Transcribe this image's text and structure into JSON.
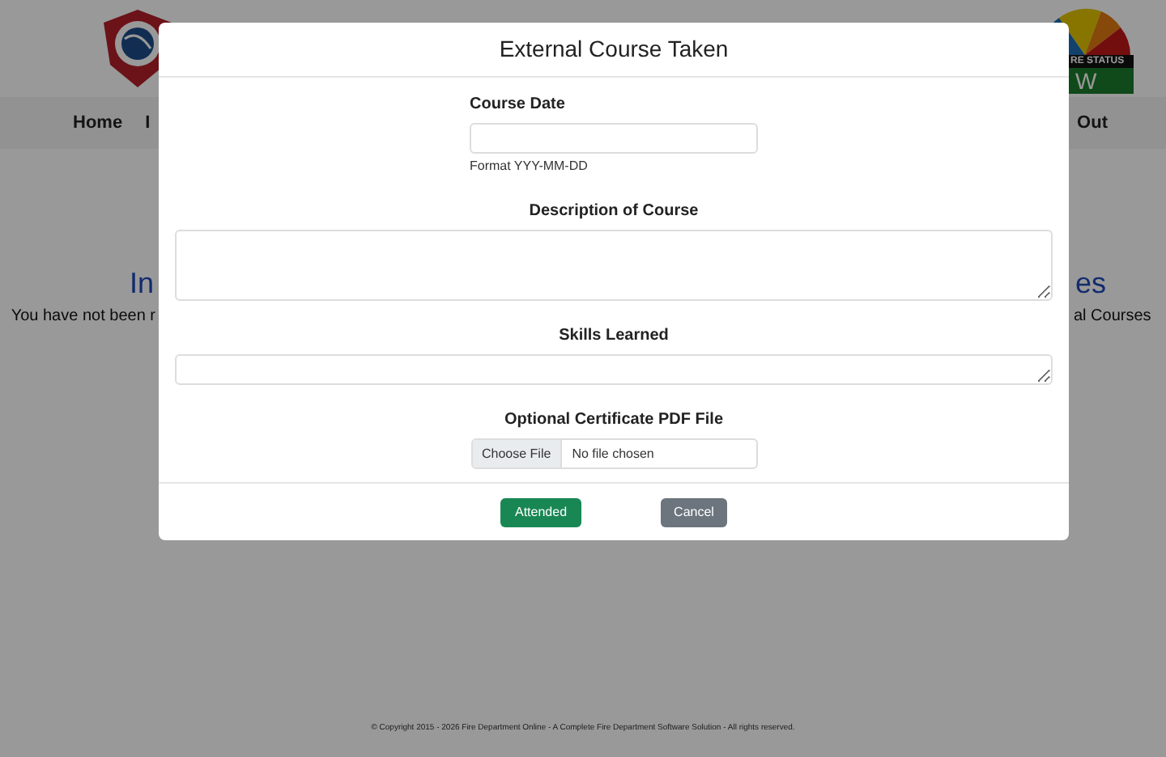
{
  "page": {
    "nav": [
      {
        "label": "Home"
      },
      {
        "label": "I"
      }
    ],
    "nav_right": [
      {
        "label": "Out"
      }
    ],
    "gauge_logo": {
      "band": "RE STATUS",
      "letter": "W"
    },
    "heading": {
      "left": "In",
      "right": "es"
    },
    "message": {
      "left": "You have not been r",
      "right": "al Courses"
    },
    "footer": "© Copyright 2015 - 2026 Fire Department Online - A Complete Fire Department Software Solution - All rights reserved."
  },
  "modal": {
    "title": "External Course Taken",
    "fields": [
      {
        "kind": "input",
        "label": "Course Date",
        "help": "Format YYY-MM-DD"
      },
      {
        "kind": "textarea",
        "label": "Description of Course"
      },
      {
        "kind": "textline",
        "label": "Skills Learned"
      },
      {
        "kind": "file",
        "label": "Optional Certificate PDF File",
        "button": "Choose File",
        "value": "No file chosen"
      }
    ],
    "buttons": [
      {
        "label": "Attended",
        "kind": "primary"
      },
      {
        "label": "Cancel",
        "kind": "secondary"
      }
    ]
  }
}
